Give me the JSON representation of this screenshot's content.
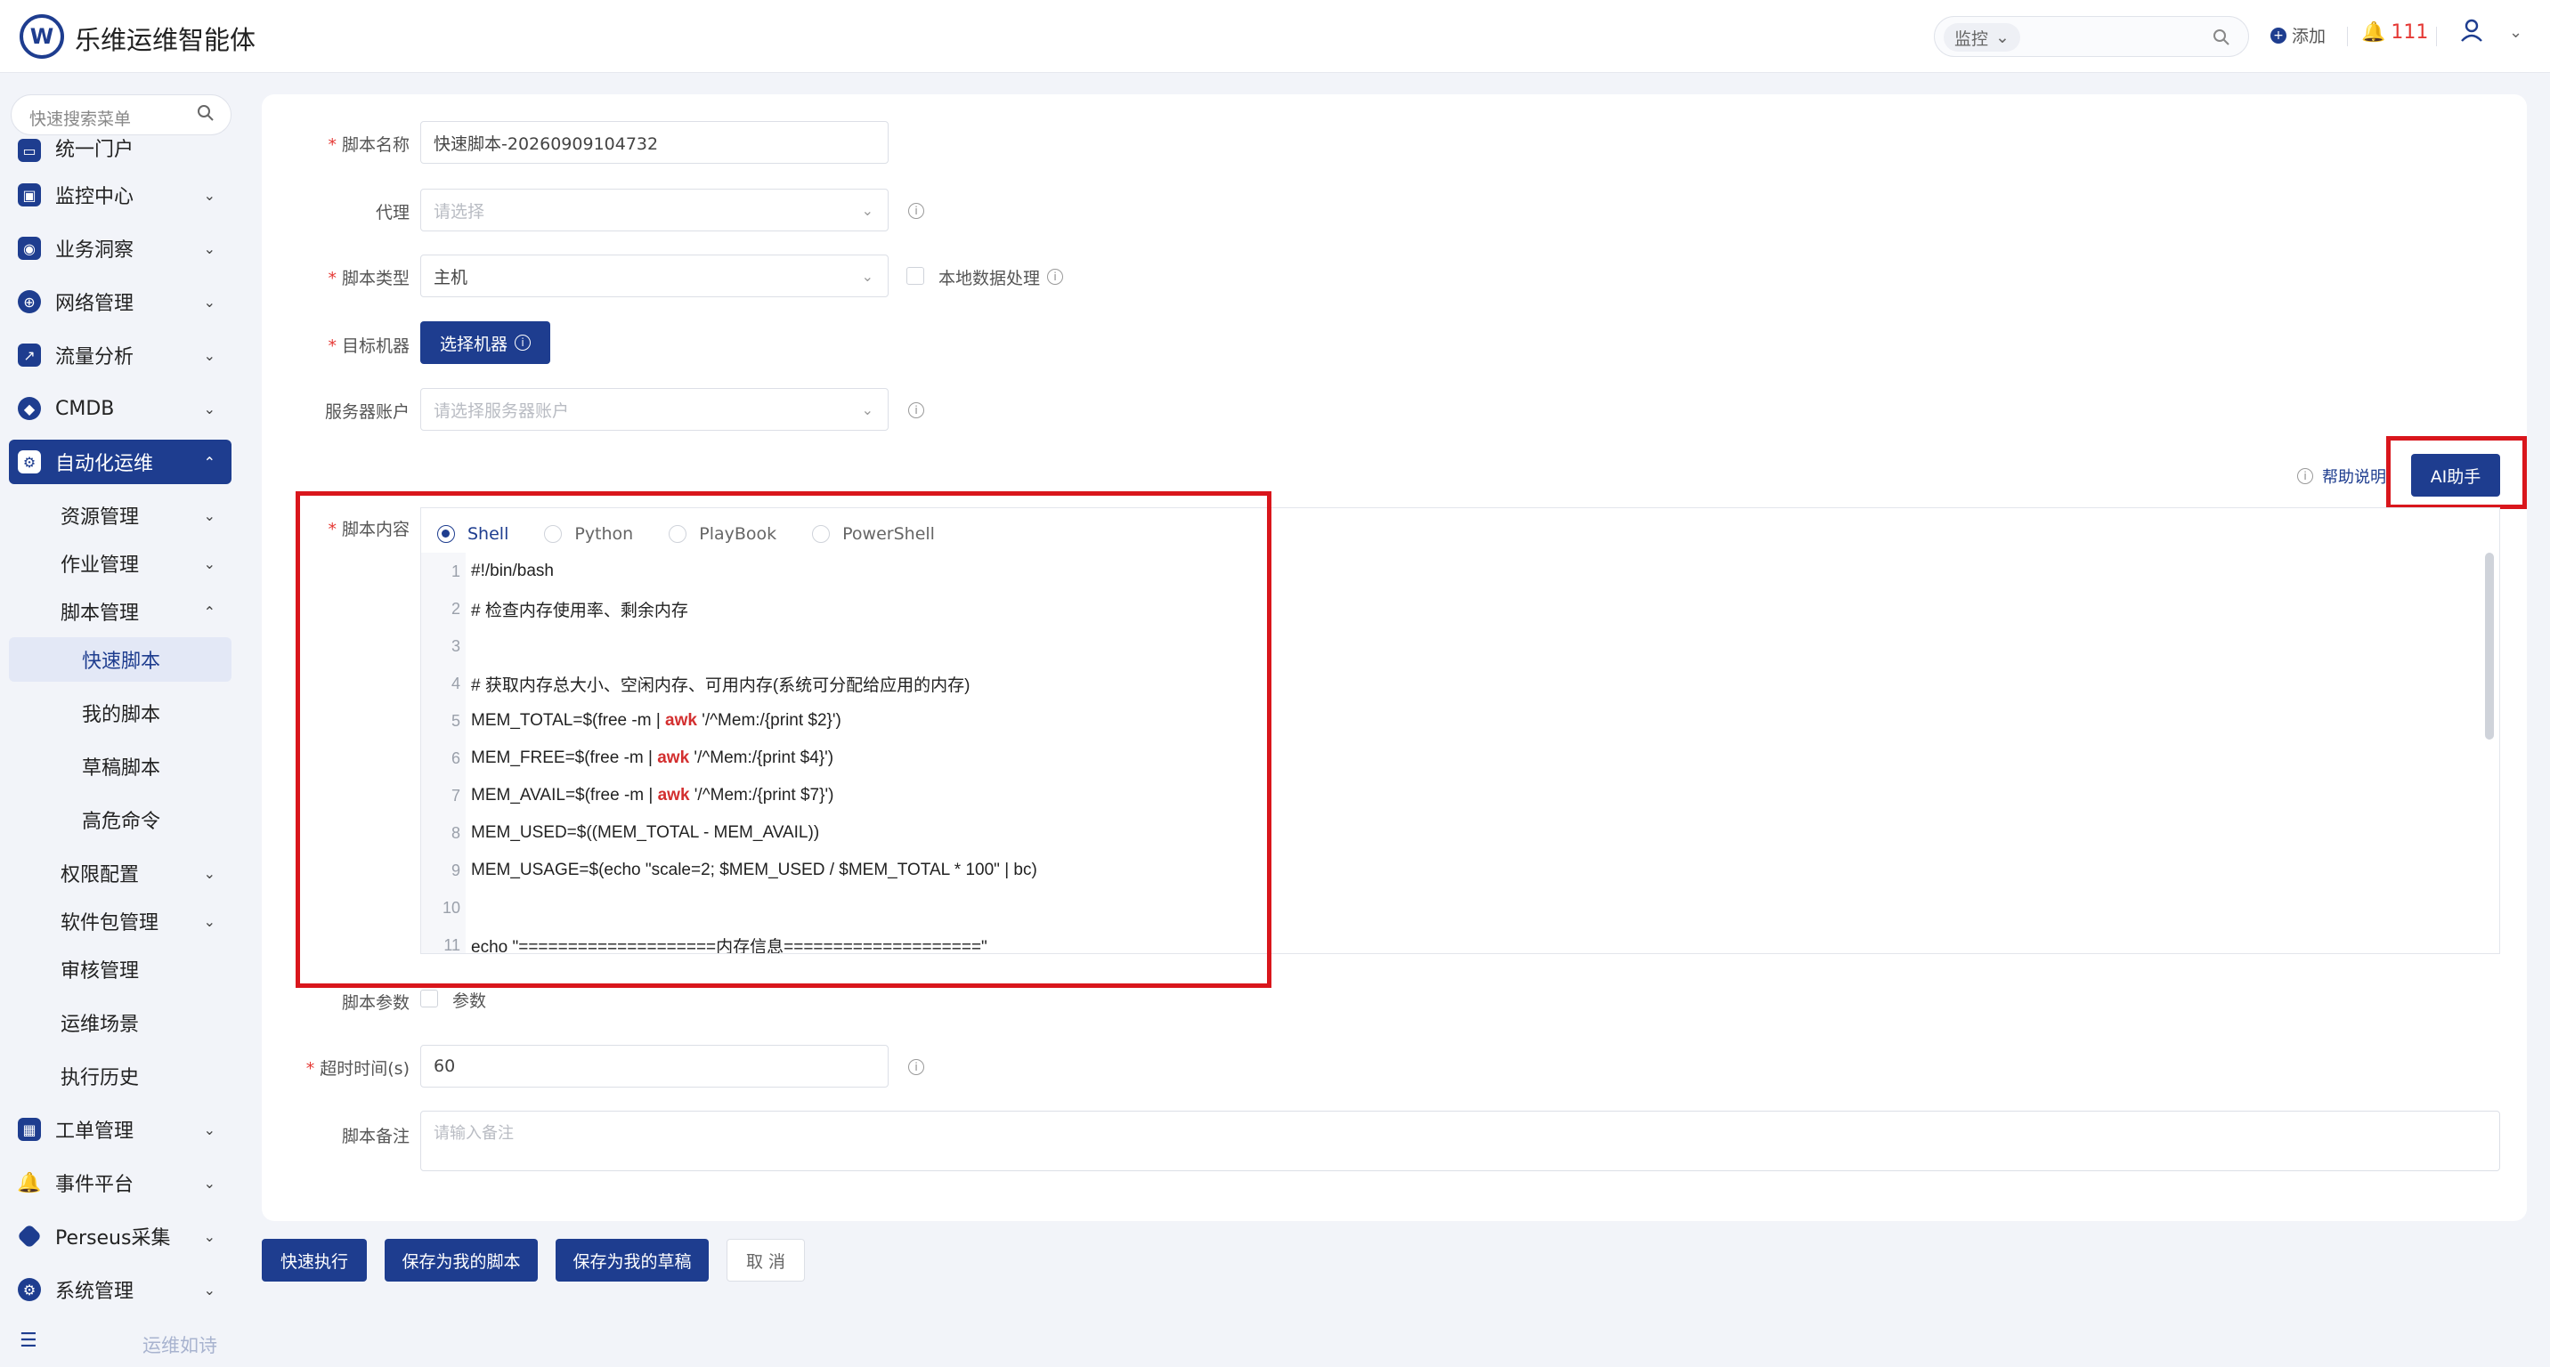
{
  "header": {
    "logo_letter": "W",
    "app_title": "乐维运维智能体",
    "search_scope": "监控",
    "add_label": "添加",
    "alert_count": "111"
  },
  "sidebar": {
    "search_placeholder": "快速搜索菜单",
    "items": [
      {
        "label": "统一门户"
      },
      {
        "label": "监控中心"
      },
      {
        "label": "业务洞察"
      },
      {
        "label": "网络管理"
      },
      {
        "label": "流量分析"
      },
      {
        "label": "CMDB"
      },
      {
        "label": "自动化运维"
      },
      {
        "label": "资源管理"
      },
      {
        "label": "作业管理"
      },
      {
        "label": "脚本管理"
      },
      {
        "label": "快速脚本"
      },
      {
        "label": "我的脚本"
      },
      {
        "label": "草稿脚本"
      },
      {
        "label": "高危命令"
      },
      {
        "label": "权限配置"
      },
      {
        "label": "软件包管理"
      },
      {
        "label": "审核管理"
      },
      {
        "label": "运维场景"
      },
      {
        "label": "执行历史"
      },
      {
        "label": "工单管理"
      },
      {
        "label": "事件平台"
      },
      {
        "label": "Perseus采集"
      },
      {
        "label": "系统管理"
      }
    ],
    "footer_text": "运维如诗"
  },
  "form": {
    "script_name": {
      "label": "脚本名称",
      "value": "快速脚本-20260909104732"
    },
    "proxy": {
      "label": "代理",
      "placeholder": "请选择"
    },
    "script_type": {
      "label": "脚本类型",
      "value": "主机",
      "checkbox_label": "本地数据处理"
    },
    "target_machine": {
      "label": "目标机器",
      "button_label": "选择机器"
    },
    "server_account": {
      "label": "服务器账户",
      "placeholder": "请选择服务器账户"
    },
    "help_label": "帮助说明",
    "ai_button": "AI助手",
    "script_content": {
      "label": "脚本内容",
      "languages": [
        "Shell",
        "Python",
        "PlayBook",
        "PowerShell"
      ],
      "selected_language": "Shell"
    },
    "script_params": {
      "label": "脚本参数",
      "checkbox_label": "参数"
    },
    "timeout": {
      "label": "超时时间(s)",
      "value": "60"
    },
    "remark": {
      "label": "脚本备注",
      "placeholder": "请输入备注"
    }
  },
  "code_lines": [
    {
      "n": "1",
      "pre": "#!/bin/bash",
      "kw": "",
      "post": ""
    },
    {
      "n": "2",
      "pre": "# 检查内存使用率、剩余内存",
      "kw": "",
      "post": ""
    },
    {
      "n": "3",
      "pre": "",
      "kw": "",
      "post": ""
    },
    {
      "n": "4",
      "pre": "# 获取内存总大小、空闲内存、可用内存(系统可分配给应用的内存)",
      "kw": "",
      "post": ""
    },
    {
      "n": "5",
      "pre": "MEM_TOTAL=$(free -m | ",
      "kw": "awk",
      "post": " '/^Mem:/{print $2}')"
    },
    {
      "n": "6",
      "pre": "MEM_FREE=$(free -m | ",
      "kw": "awk",
      "post": " '/^Mem:/{print $4}')"
    },
    {
      "n": "7",
      "pre": "MEM_AVAIL=$(free -m | ",
      "kw": "awk",
      "post": " '/^Mem:/{print $7}')"
    },
    {
      "n": "8",
      "pre": "MEM_USED=$((MEM_TOTAL - MEM_AVAIL))",
      "kw": "",
      "post": ""
    },
    {
      "n": "9",
      "pre": "MEM_USAGE=$(echo \"scale=2; $MEM_USED / $MEM_TOTAL * 100\" | bc)",
      "kw": "",
      "post": ""
    },
    {
      "n": "10",
      "pre": "",
      "kw": "",
      "post": ""
    },
    {
      "n": "11",
      "pre": "echo \"====================内存信息====================\"",
      "kw": "",
      "post": ""
    }
  ],
  "actions": {
    "quick_run": "快速执行",
    "save_mine": "保存为我的脚本",
    "save_draft": "保存为我的草稿",
    "cancel": "取 消"
  },
  "colors": {
    "brand": "#1e3d8f",
    "highlight_box": "#d9161c",
    "keyword": "#d32f2f"
  }
}
